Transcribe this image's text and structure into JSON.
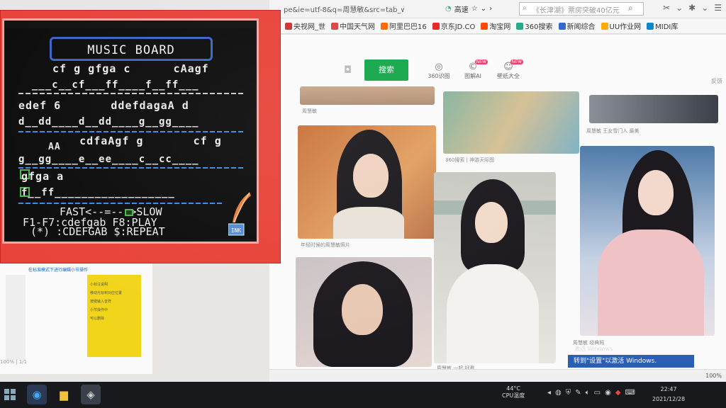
{
  "browser": {
    "url": "pe&ie=utf-8&q=周慧敏&src=tab_web",
    "quick_links": [
      "高速"
    ],
    "search_placeholder": "《长津湖》票房突破40亿元",
    "bookmarks": [
      "央视网_世",
      "中国天气网",
      "阿里巴巴16",
      "京东JD.CO",
      "淘宝网",
      "360搜索",
      "新闻综合",
      "UU作业网",
      "MIDI库"
    ]
  },
  "search_page": {
    "search_button": "搜索",
    "nav": [
      {
        "label": "360识图",
        "badge": ""
      },
      {
        "label": "图解AI",
        "badge": "NEW"
      },
      {
        "label": "壁纸大全",
        "badge": "NEW"
      }
    ],
    "feedback": "反馈",
    "captions": [
      "周慧敏",
      "周慧敏 王女雪门人 最美",
      "360搜索 | 神游天际图",
      "年轻时候的周慧敏照片",
      "周慧敏 一起 好看",
      "周慧敏 经典照"
    ],
    "activate_hint": "转到\"设置\"以激活 Windows.",
    "activate_hint_small": "激活 Windows",
    "zoom": "100%"
  },
  "editor": {
    "title": "在标准模式下进行编辑小节操作",
    "sticky_lines": [
      "小标注说明",
      "移动光标到对应位置",
      "",
      "按键输入音符",
      "小节操作中",
      "可以删除"
    ],
    "footer": "100% | 1/1"
  },
  "music_board": {
    "title": "MUSIC  BOARD",
    "rows": [
      {
        "notes": " cf g gfga c      cAagf",
        "line": "  ___c__cf___ff____f__ff___"
      },
      {
        "notes": "edef 6       ddefdagaA d",
        "line": "d__dd____d__dd____g__gg____"
      },
      {
        "notes": "     cdfaAgf g       cf g",
        "line": "g__gg____e__ee____c__cc____",
        "extra": "AA"
      },
      {
        "notes": "gfga a",
        "line": "f__ff__________________"
      }
    ],
    "speed": "FAST<--=--->SLOW",
    "fkeys": "F1-F7:cdefgab F8:PLAY",
    "keys2": " (*) :CDEFGAB $:REPEAT",
    "ink_label": "INK"
  },
  "taskbar": {
    "temp": "44°C",
    "temp_label": "CPU温度",
    "time": "22:47",
    "date": "2021/12/28"
  }
}
